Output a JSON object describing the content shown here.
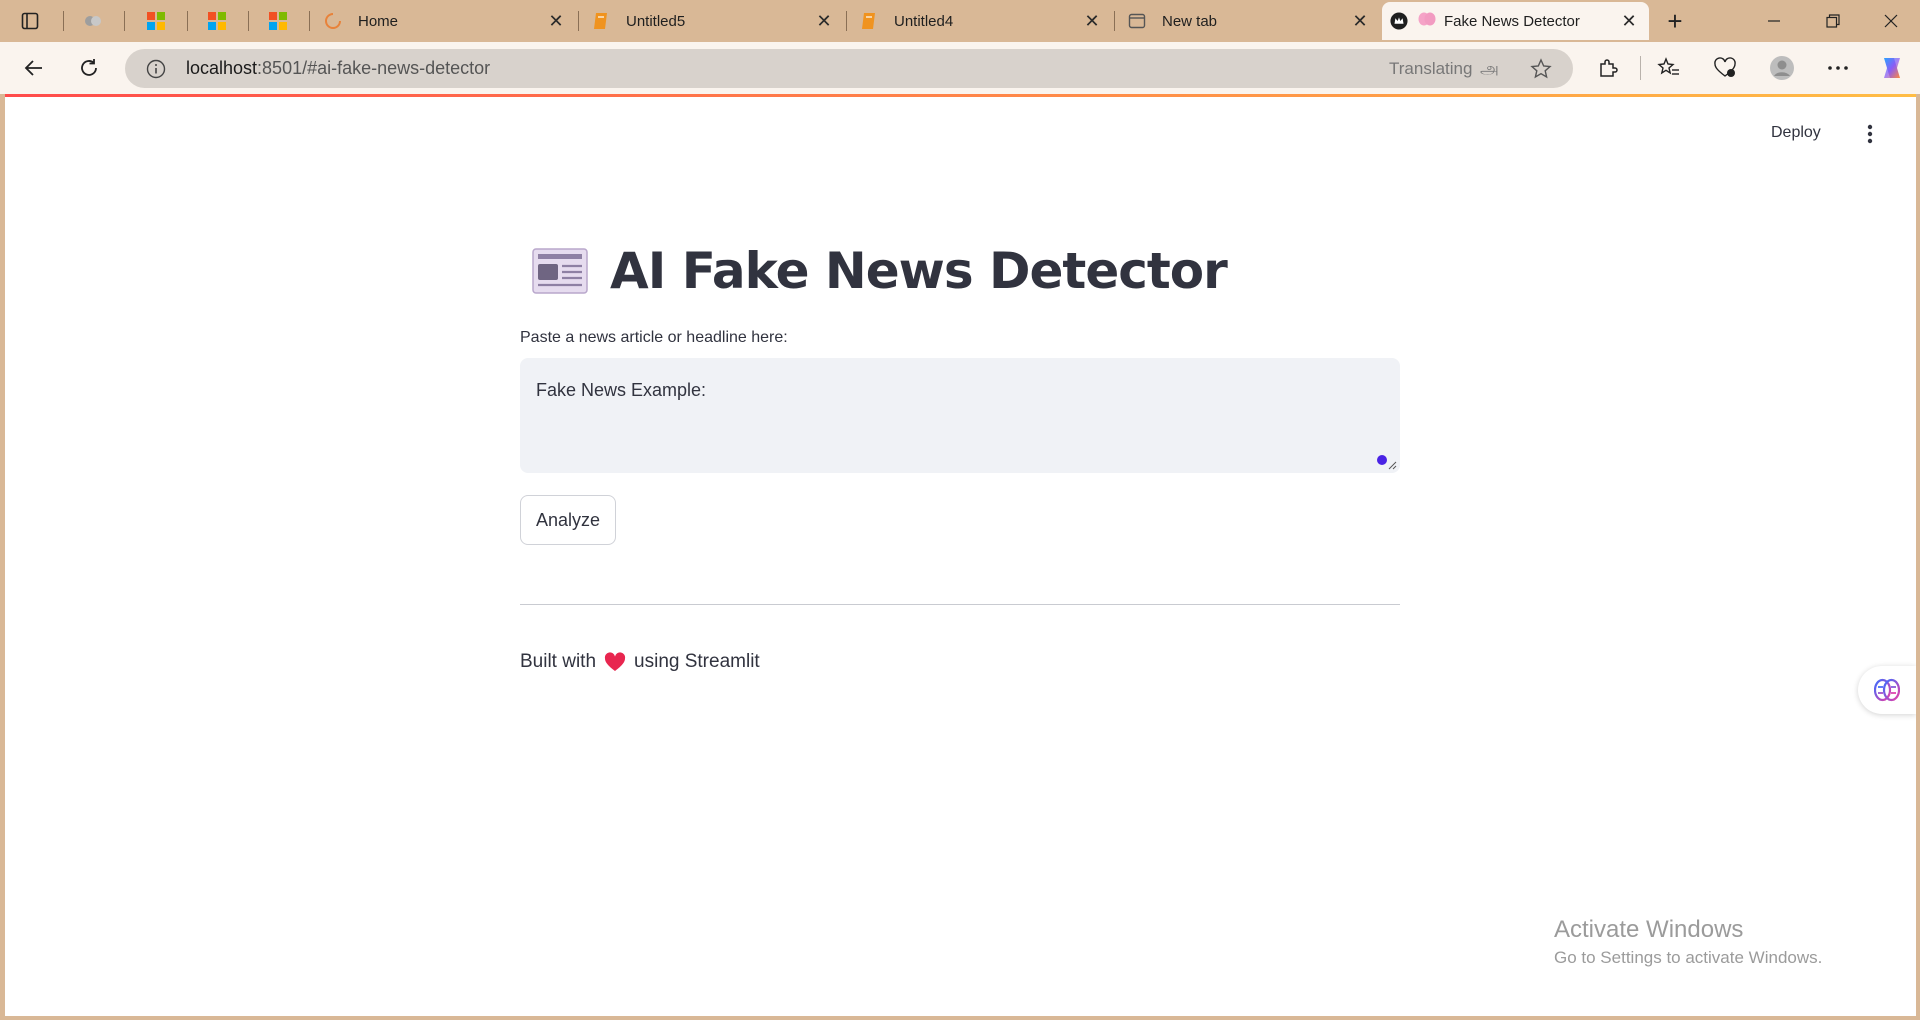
{
  "browser": {
    "tabs": [
      {
        "title": "Home",
        "favicon": "loading-spinner-icon"
      },
      {
        "title": "Untitled5",
        "favicon": "jupyter-notebook-icon"
      },
      {
        "title": "Untitled4",
        "favicon": "jupyter-notebook-icon"
      },
      {
        "title": "New tab",
        "favicon": "new-tab-icon"
      },
      {
        "title": "Fake News Detector",
        "favicon": "brain-icon",
        "active": true
      }
    ],
    "close_glyph": "✕",
    "new_tab_glyph": "+",
    "address": {
      "host": "localhost",
      "path": ":8501/#ai-fake-news-detector",
      "translating_label": "Translating",
      "translate_glyph": "அ"
    }
  },
  "app": {
    "deploy_label": "Deploy",
    "title": "AI Fake News Detector",
    "input_label": "Paste a news article or headline here:",
    "input_value": "Fake News Example:",
    "analyze_label": "Analyze",
    "footer": {
      "before": "Built with",
      "after": "using Streamlit"
    }
  },
  "os_overlay": {
    "activate_title": "Activate Windows",
    "activate_subtitle": "Go to Settings to activate Windows."
  },
  "colors": {
    "tabstrip_bg": "#d9b896",
    "toolbar_bg": "#faf4ee",
    "text_primary": "#31333f",
    "input_bg": "#f0f2f6",
    "heart": "#e8264f"
  }
}
